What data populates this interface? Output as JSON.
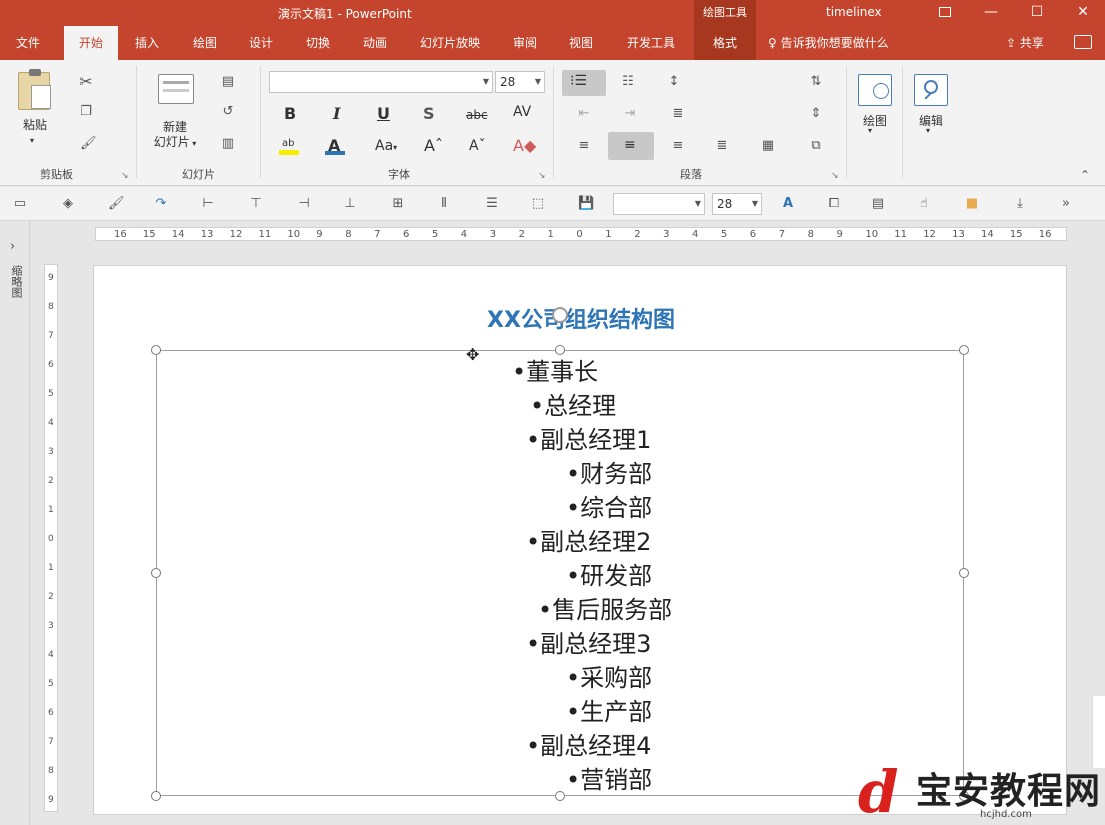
{
  "titlebar": {
    "title": "演示文稿1  -  PowerPoint",
    "context_tool": "绘图工具",
    "user": "timelinex",
    "restore_icon": "ribbon-display-icon",
    "min": "—",
    "max": "☐",
    "close": "✕"
  },
  "tabs": [
    "文件",
    "开始",
    "插入",
    "绘图",
    "设计",
    "切换",
    "动画",
    "幻灯片放映",
    "审阅",
    "视图",
    "开发工具",
    "格式"
  ],
  "tell_me": "告诉我你想要做什么",
  "share": "共享",
  "ribbon": {
    "clipboard": {
      "paste": "粘贴",
      "label": "剪贴板"
    },
    "slides": {
      "new_slide": "新建\n幻灯片",
      "new_slide_line1": "新建",
      "new_slide_line2": "幻灯片",
      "label": "幻灯片"
    },
    "font": {
      "font_name": "",
      "font_size": "28",
      "bold": "B",
      "italic": "I",
      "underline": "U",
      "shadow": "S",
      "strike": "abc",
      "spacing": "AV",
      "label": "字体",
      "case": "Aa"
    },
    "paragraph": {
      "label": "段落"
    },
    "drawing": {
      "label": "绘图"
    },
    "editing": {
      "label": "编辑"
    }
  },
  "qat": {
    "font_name": "",
    "font_size": "28"
  },
  "outline_pane": {
    "label": "缩略图"
  },
  "hruler": [
    "16",
    "15",
    "14",
    "13",
    "12",
    "11",
    "10",
    "9",
    "8",
    "7",
    "6",
    "5",
    "4",
    "3",
    "2",
    "1",
    "0",
    "1",
    "2",
    "3",
    "4",
    "5",
    "6",
    "7",
    "8",
    "9",
    "10",
    "11",
    "12",
    "13",
    "14",
    "15",
    "16"
  ],
  "vruler": [
    "9",
    "8",
    "7",
    "6",
    "5",
    "4",
    "3",
    "2",
    "1",
    "0",
    "1",
    "2",
    "3",
    "4",
    "5",
    "6",
    "7",
    "8",
    "9"
  ],
  "slide": {
    "title": "XX公司组织结构图",
    "lines": [
      {
        "text": "•董事长"
      },
      {
        "text": "•总经理"
      },
      {
        "text": "•副总经理1"
      },
      {
        "text": "•财务部"
      },
      {
        "text": "•综合部"
      },
      {
        "text": "•副总经理2"
      },
      {
        "text": "•研发部"
      },
      {
        "text": "•售后服务部"
      },
      {
        "text": "•副总经理3"
      },
      {
        "text": "•采购部"
      },
      {
        "text": "•生产部"
      },
      {
        "text": "•副总经理4"
      },
      {
        "text": "•营销部"
      }
    ]
  },
  "watermark": {
    "name": "宝安教程网",
    "url": "hcjhd.com"
  },
  "colors": {
    "accent": "#c4442d",
    "title_blue": "#2e75b6"
  }
}
